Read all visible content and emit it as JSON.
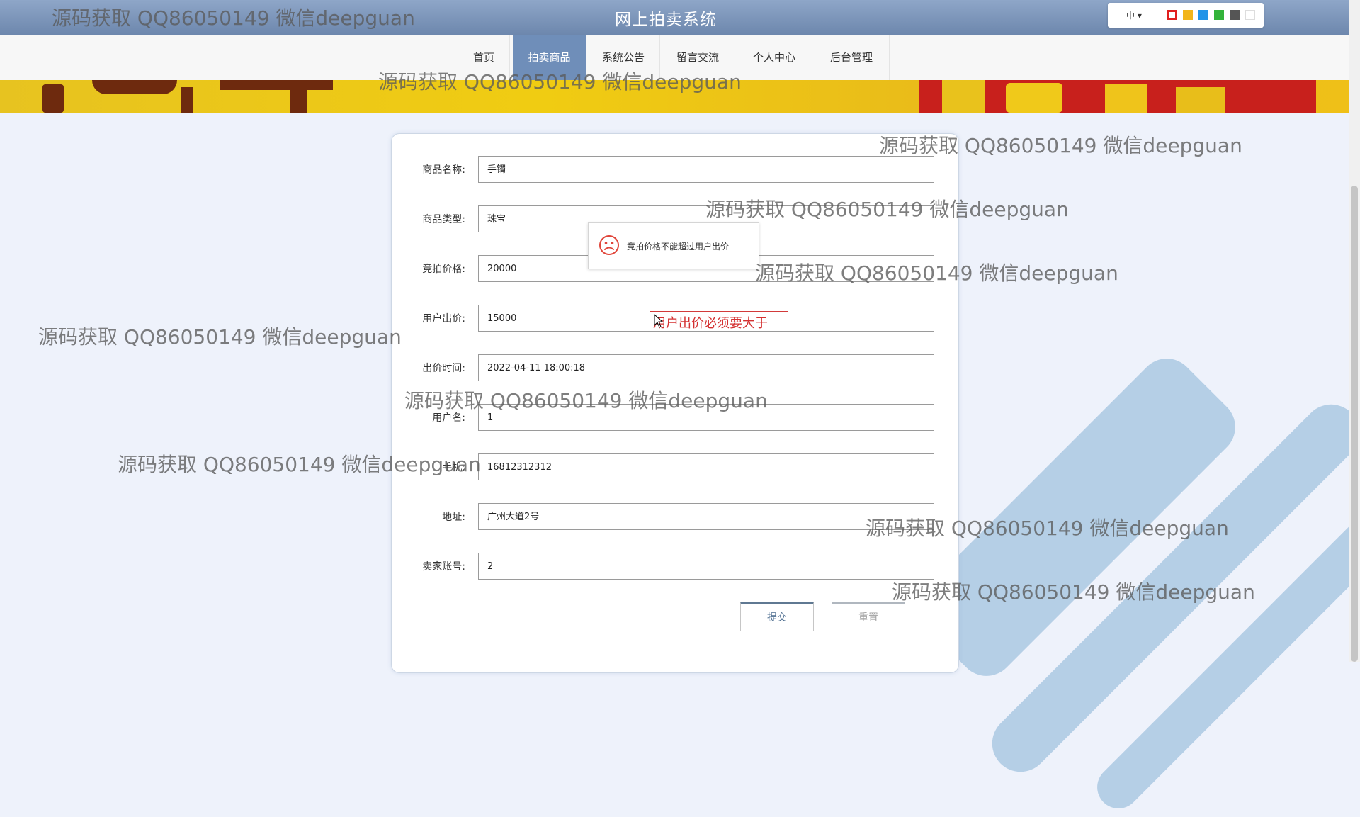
{
  "site_title": "网上拍卖系统",
  "lang_selector": "中",
  "theme_colors": [
    "#e01f1f",
    "#f2b51a",
    "#2294e8",
    "#33b33a",
    "#555555",
    "#ffffff"
  ],
  "nav": {
    "items": [
      {
        "label": "首页",
        "active": false
      },
      {
        "label": "拍卖商品",
        "active": true
      },
      {
        "label": "系统公告",
        "active": false
      },
      {
        "label": "留言交流",
        "active": false
      },
      {
        "label": "个人中心",
        "active": false
      },
      {
        "label": "后台管理",
        "active": false
      }
    ]
  },
  "form": {
    "fields": [
      {
        "label": "商品名称:",
        "value": "手镯"
      },
      {
        "label": "商品类型:",
        "value": "珠宝"
      },
      {
        "label": "竞拍价格:",
        "value": "20000"
      },
      {
        "label": "用户出价:",
        "value": "15000"
      },
      {
        "label": "出价时间:",
        "value": "2022-04-11 18:00:18"
      },
      {
        "label": "用户名:",
        "value": "1"
      },
      {
        "label": "手机:",
        "value": "16812312312"
      },
      {
        "label": "地址:",
        "value": "广州大道2号"
      },
      {
        "label": "卖家账号:",
        "value": "2"
      }
    ],
    "submit_label": "提交",
    "reset_label": "重置"
  },
  "toast": {
    "message": "竞拍价格不能超过用户出价",
    "icon": "sad-face-icon"
  },
  "validation_error": "用户出价必须要大于",
  "watermark_text": "源码获取 QQ86050149 微信deepguan"
}
